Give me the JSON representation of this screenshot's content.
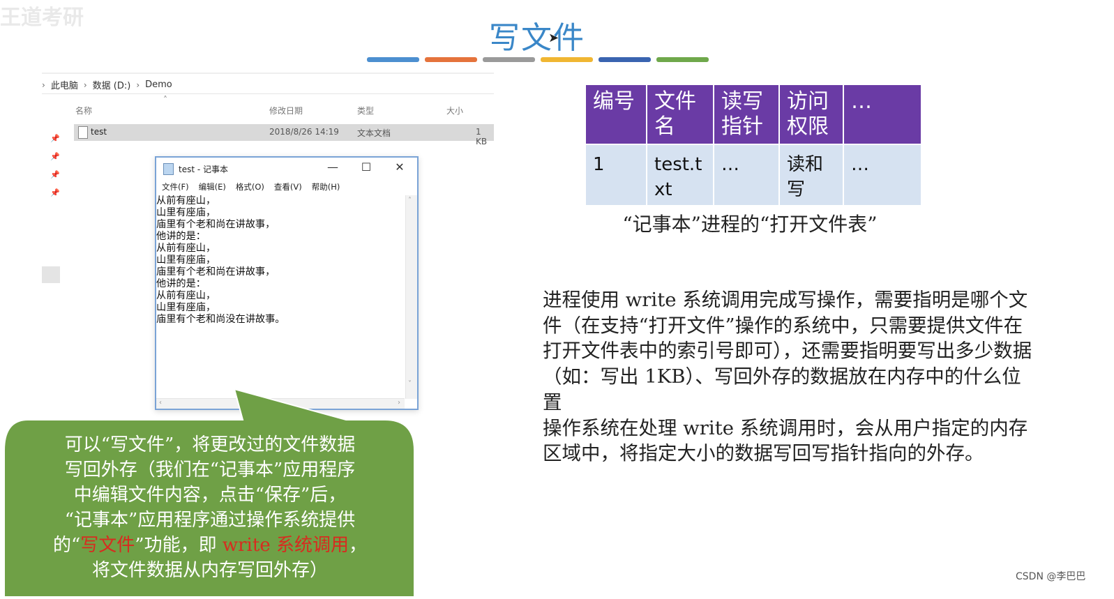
{
  "slide": {
    "title": "写文件",
    "color_bars": [
      "#4c8fd0",
      "#e5733c",
      "#9a9a9a",
      "#f0b632",
      "#3a64b0",
      "#6fa84b"
    ],
    "watermark": "王道考研"
  },
  "explorer": {
    "breadcrumb": [
      "此电脑",
      "数据 (D:)",
      "Demo"
    ],
    "columns": {
      "name": "名称",
      "modified": "修改日期",
      "type": "类型",
      "size": "大小"
    },
    "rows": [
      {
        "name": "test",
        "modified": "2018/8/26 14:19",
        "type": "文本文档",
        "size": "1 KB"
      }
    ]
  },
  "notepad": {
    "title": "test - 记事本",
    "controls": {
      "minimize": "—",
      "maximize": "☐",
      "close": "✕"
    },
    "menu": [
      "文件(F)",
      "编辑(E)",
      "格式(O)",
      "查看(V)",
      "帮助(H)"
    ],
    "content": "从前有座山，\n山里有座庙，\n庙里有个老和尚在讲故事，\n他讲的是：\n从前有座山，\n山里有座庙，\n庙里有个老和尚在讲故事，\n他讲的是：\n从前有座山，\n山里有座庙，\n庙里有个老和尚没在讲故事。"
  },
  "bubble": {
    "line1": "可以“写文件”，将更改过的文件数据",
    "line2": "写回外存（我们在“记事本”应用程序",
    "line3": "中编辑文件内容，点击“保存”后，",
    "line4": "“记事本”应用程序通过操作系统提供",
    "line5_prefix": "的“",
    "line5_red1": "写文件",
    "line5_mid": "”功能，即 ",
    "line5_red2": "write 系统调用",
    "line5_suffix": "，",
    "line6": "将文件数据从内存写回外存）",
    "fill": "#6fa046"
  },
  "open_file_table": {
    "headers": [
      "编号",
      "文件名",
      "读写指针",
      "访问权限",
      "…"
    ],
    "header_lines": [
      [
        "编号"
      ],
      [
        "文件",
        "名"
      ],
      [
        "读写",
        "指针"
      ],
      [
        "访问",
        "权限"
      ],
      [
        "…"
      ]
    ],
    "row": [
      "1",
      "test.txt",
      "…",
      "读和写",
      "…"
    ],
    "row_lines": [
      [
        "1"
      ],
      [
        "test.t",
        "xt"
      ],
      [
        "…"
      ],
      [
        "读和",
        "写"
      ],
      [
        "…"
      ]
    ],
    "caption": "“记事本”进程的“打开文件表”",
    "header_color": "#6a3ba5",
    "row_color": "#d6e2f1"
  },
  "explanation": {
    "para1": "进程使用 write 系统调用完成写操作，需要指明是哪个文件（在支持“打开文件”操作的系统中，只需要提供文件在打开文件表中的索引号即可），还需要指明要写出多少数据（如：写出 1KB）、写回外存的数据放在内存中的什么位置",
    "para2": "操作系统在处理 write 系统调用时，会从用户指定的内存区域中，将指定大小的数据写回写指针指向的外存。"
  },
  "footer": {
    "credit": "CSDN @李巴巴"
  }
}
